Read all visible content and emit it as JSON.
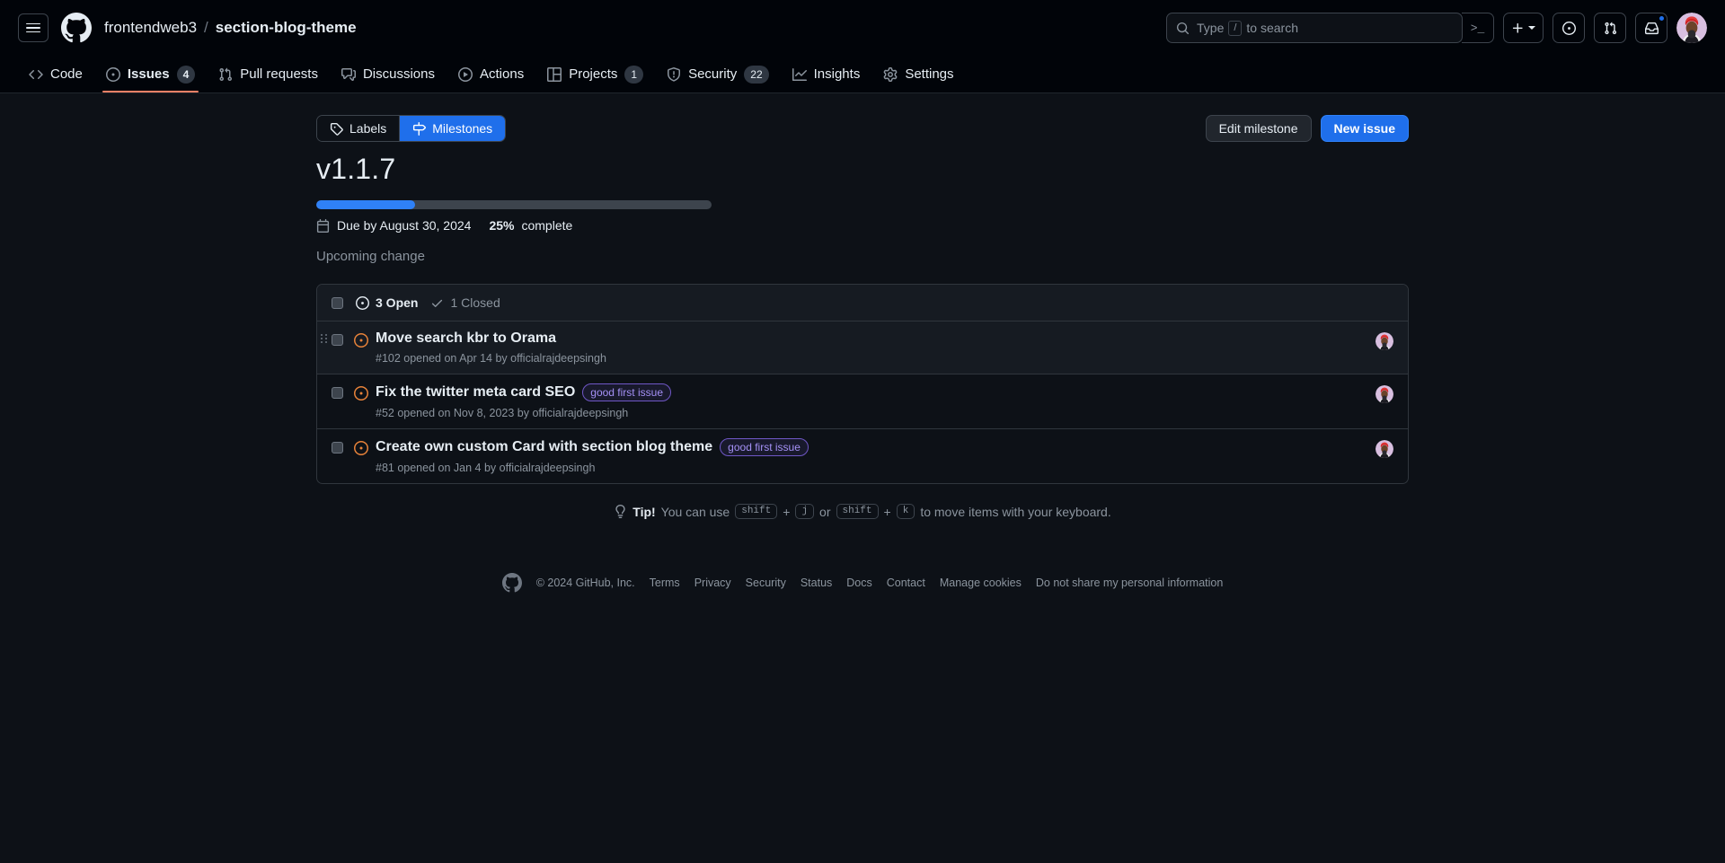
{
  "header": {
    "owner": "frontendweb3",
    "separator": "/",
    "repo": "section-blog-theme",
    "search_placeholder": "Type",
    "search_key": "/",
    "search_placeholder_suffix": "to search",
    "command_glyph": ">_"
  },
  "repo_nav": [
    {
      "label": "Code",
      "icon": "code-icon",
      "count": null,
      "active": false
    },
    {
      "label": "Issues",
      "icon": "issue-opened-icon",
      "count": "4",
      "active": true
    },
    {
      "label": "Pull requests",
      "icon": "git-pull-request-icon",
      "count": null,
      "active": false
    },
    {
      "label": "Discussions",
      "icon": "comment-discussion-icon",
      "count": null,
      "active": false
    },
    {
      "label": "Actions",
      "icon": "play-icon",
      "count": null,
      "active": false
    },
    {
      "label": "Projects",
      "icon": "project-icon",
      "count": "1",
      "active": false
    },
    {
      "label": "Security",
      "icon": "shield-icon",
      "count": "22",
      "active": false
    },
    {
      "label": "Insights",
      "icon": "graph-icon",
      "count": null,
      "active": false
    },
    {
      "label": "Settings",
      "icon": "gear-icon",
      "count": null,
      "active": false
    }
  ],
  "subnav": {
    "labels_tab": "Labels",
    "milestones_tab": "Milestones",
    "edit_milestone_button": "Edit milestone",
    "new_issue_button": "New issue"
  },
  "milestone": {
    "title": "v1.1.7",
    "progress_percent": 25,
    "due_date": "Due by August 30, 2024",
    "percent_value": "25%",
    "percent_label": "complete",
    "description": "Upcoming change"
  },
  "issues_header": {
    "open_count": "3 Open",
    "closed_count": "1 Closed"
  },
  "issues": [
    {
      "title": "Move search kbr to Orama",
      "state": "open",
      "labels": [],
      "meta": "#102 opened on Apr 14 by officialrajdeepsingh",
      "hovered": true
    },
    {
      "title": "Fix the twitter meta card SEO",
      "state": "open",
      "labels": [
        "good first issue"
      ],
      "meta": "#52 opened on Nov 8, 2023 by officialrajdeepsingh",
      "hovered": false
    },
    {
      "title": "Create own custom Card with section blog theme",
      "state": "open",
      "labels": [
        "good first issue"
      ],
      "meta": "#81 opened on Jan 4 by officialrajdeepsingh",
      "hovered": false
    }
  ],
  "tip": {
    "prefix": "Tip!",
    "text_1": "You can use",
    "key_1": "shift",
    "plus_1": "+",
    "key_2": "j",
    "or": "or",
    "key_3": "shift",
    "plus_2": "+",
    "key_4": "k",
    "text_2": "to move items with your keyboard."
  },
  "footer": {
    "copyright": "© 2024 GitHub, Inc.",
    "links": [
      "Terms",
      "Privacy",
      "Security",
      "Status",
      "Docs",
      "Contact",
      "Manage cookies",
      "Do not share my personal information"
    ]
  },
  "colors": {
    "accent_blue": "#1f6feb",
    "open_orange": "#e8833a",
    "label_purple": "#a490f5",
    "page_bg": "#0d1117",
    "header_bg": "#010409"
  }
}
